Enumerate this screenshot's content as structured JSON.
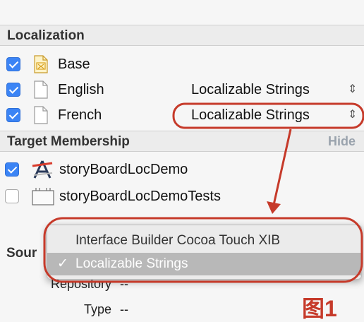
{
  "localization": {
    "header": "Localization",
    "items": [
      {
        "checked": true,
        "icon": "xib-file-icon",
        "name": "Base",
        "value": ""
      },
      {
        "checked": true,
        "icon": "document-icon",
        "name": "English",
        "value": "Localizable Strings"
      },
      {
        "checked": true,
        "icon": "document-icon",
        "name": "French",
        "value": "Localizable Strings"
      }
    ]
  },
  "target_membership": {
    "header": "Target Membership",
    "hide_label": "Hide",
    "targets": [
      {
        "checked": true,
        "icon": "app-target-icon",
        "name": "storyBoardLocDemo"
      },
      {
        "checked": false,
        "icon": "test-bundle-icon",
        "name": "storyBoardLocDemoTests"
      }
    ]
  },
  "popup_menu": {
    "items": [
      {
        "label": "Interface Builder Cocoa Touch XIB",
        "selected": false
      },
      {
        "label": "Localizable Strings",
        "selected": true
      }
    ],
    "check_glyph": "✓"
  },
  "source_control": {
    "header_partial": "Sour",
    "repository_label": "Repository",
    "repository_value": "--",
    "type_label": "Type",
    "type_value": "--"
  },
  "annotation": {
    "figure_label": "图1",
    "color": "#c63a2a"
  }
}
